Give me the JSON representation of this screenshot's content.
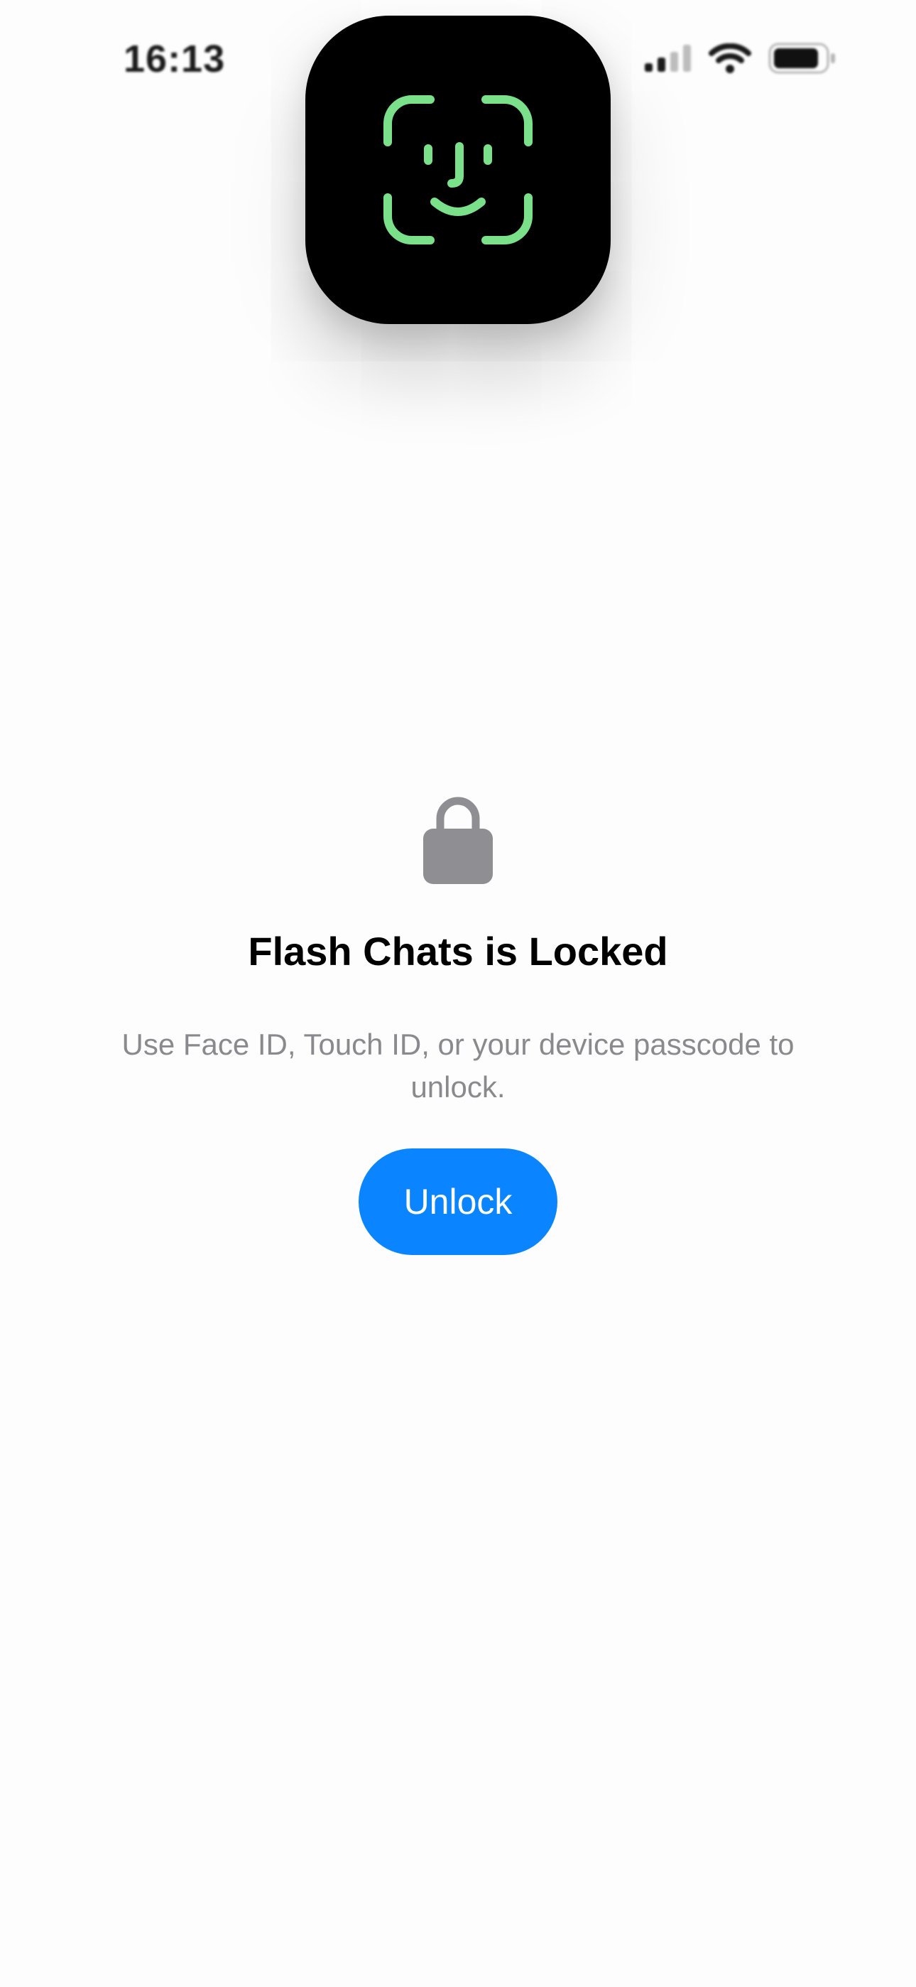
{
  "status_bar": {
    "time": "16:13",
    "icons": [
      "cellular-signal-icon",
      "wifi-icon",
      "battery-icon"
    ]
  },
  "face_id": {
    "icon": "face-id-icon",
    "color": "#7be08a"
  },
  "lock_screen": {
    "icon": "lock-icon",
    "title": "Flash Chats is Locked",
    "subtitle": "Use Face ID, Touch ID, or your device passcode to unlock.",
    "unlock_label": "Unlock",
    "accent_color": "#0a84ff"
  }
}
